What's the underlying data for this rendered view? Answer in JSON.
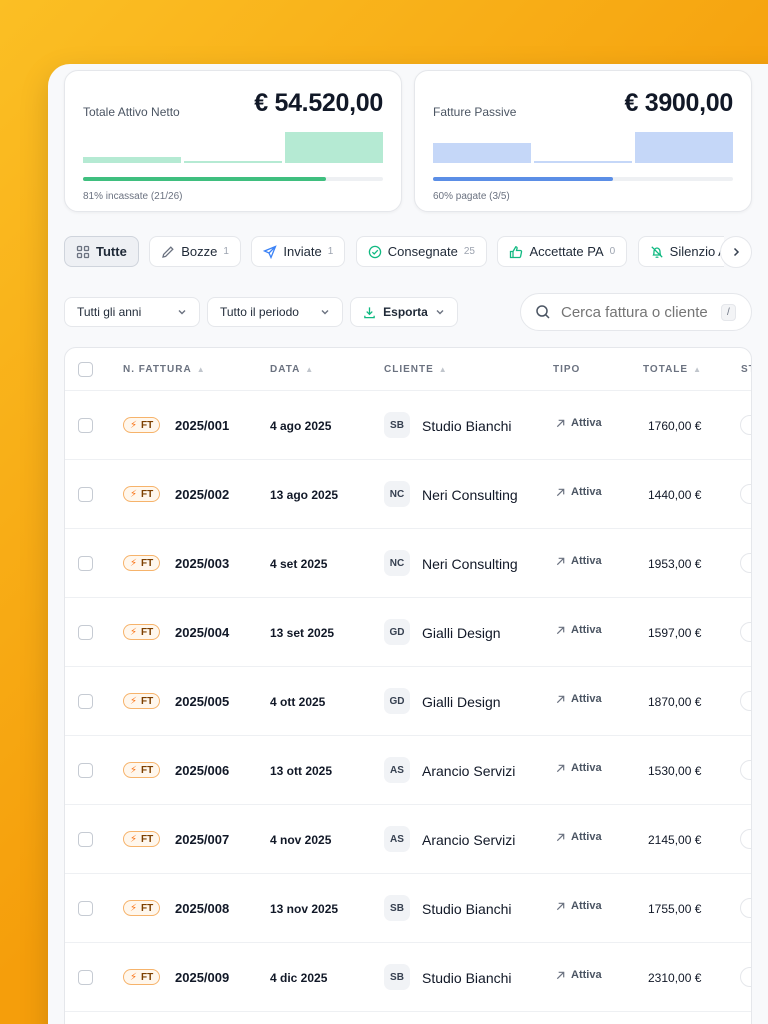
{
  "colors": {
    "accent_green": "#3fbf7f",
    "accent_blue": "#5b8ee6",
    "bar_green": "#b5ead3",
    "bar_blue": "#c5d7f8",
    "background": "#f59e0b"
  },
  "cards": [
    {
      "label": "Totale Attivo Netto",
      "amount": "€ 54.520,00",
      "progress_fraction": 0.81,
      "caption": "81% incassate (21/26)"
    },
    {
      "label": "Fatture Passive",
      "amount": "€ 3900,00",
      "progress_fraction": 0.6,
      "caption": "60% pagate (3/5)"
    }
  ],
  "filters": [
    {
      "label": "Tutte",
      "count": "",
      "icon": "grid-icon",
      "active": true
    },
    {
      "label": "Bozze",
      "count": "1",
      "icon": "pencil-icon"
    },
    {
      "label": "Inviate",
      "count": "1",
      "icon": "send-icon"
    },
    {
      "label": "Consegnate",
      "count": "25",
      "icon": "check-circle-icon"
    },
    {
      "label": "Accettate PA",
      "count": "0",
      "icon": "thumbs-up-icon"
    },
    {
      "label": "Silenzio Assenso",
      "count": "",
      "icon": "bell-off-icon"
    }
  ],
  "toolbar": {
    "year_select": "Tutti gli anni",
    "period_select": "Tutto il periodo",
    "export_label": "Esporta",
    "search_placeholder": "Cerca fattura o cliente",
    "search_shortcut": "/"
  },
  "table": {
    "headers": {
      "number": "N. FATTURA",
      "date": "DATA",
      "client": "CLIENTE",
      "type": "TIPO",
      "total": "TOTALE",
      "status": "ST"
    },
    "rows": [
      {
        "badge": "FT",
        "number": "2025/001",
        "date": "4 ago 2025",
        "initials": "SB",
        "client": "Studio Bianchi",
        "type": "Attiva",
        "total": "1760,00 €"
      },
      {
        "badge": "FT",
        "number": "2025/002",
        "date": "13 ago 2025",
        "initials": "NC",
        "client": "Neri Consulting",
        "type": "Attiva",
        "total": "1440,00 €"
      },
      {
        "badge": "FT",
        "number": "2025/003",
        "date": "4 set 2025",
        "initials": "NC",
        "client": "Neri Consulting",
        "type": "Attiva",
        "total": "1953,00 €"
      },
      {
        "badge": "FT",
        "number": "2025/004",
        "date": "13 set 2025",
        "initials": "GD",
        "client": "Gialli Design",
        "type": "Attiva",
        "total": "1597,00 €"
      },
      {
        "badge": "FT",
        "number": "2025/005",
        "date": "4 ott 2025",
        "initials": "GD",
        "client": "Gialli Design",
        "type": "Attiva",
        "total": "1870,00 €"
      },
      {
        "badge": "FT",
        "number": "2025/006",
        "date": "13 ott 2025",
        "initials": "AS",
        "client": "Arancio Servizi",
        "type": "Attiva",
        "total": "1530,00 €"
      },
      {
        "badge": "FT",
        "number": "2025/007",
        "date": "4 nov 2025",
        "initials": "AS",
        "client": "Arancio Servizi",
        "type": "Attiva",
        "total": "2145,00 €"
      },
      {
        "badge": "FT",
        "number": "2025/008",
        "date": "13 nov 2025",
        "initials": "SB",
        "client": "Studio Bianchi",
        "type": "Attiva",
        "total": "1755,00 €"
      },
      {
        "badge": "FT",
        "number": "2025/009",
        "date": "4 dic 2025",
        "initials": "SB",
        "client": "Studio Bianchi",
        "type": "Attiva",
        "total": "2310,00 €"
      }
    ]
  }
}
